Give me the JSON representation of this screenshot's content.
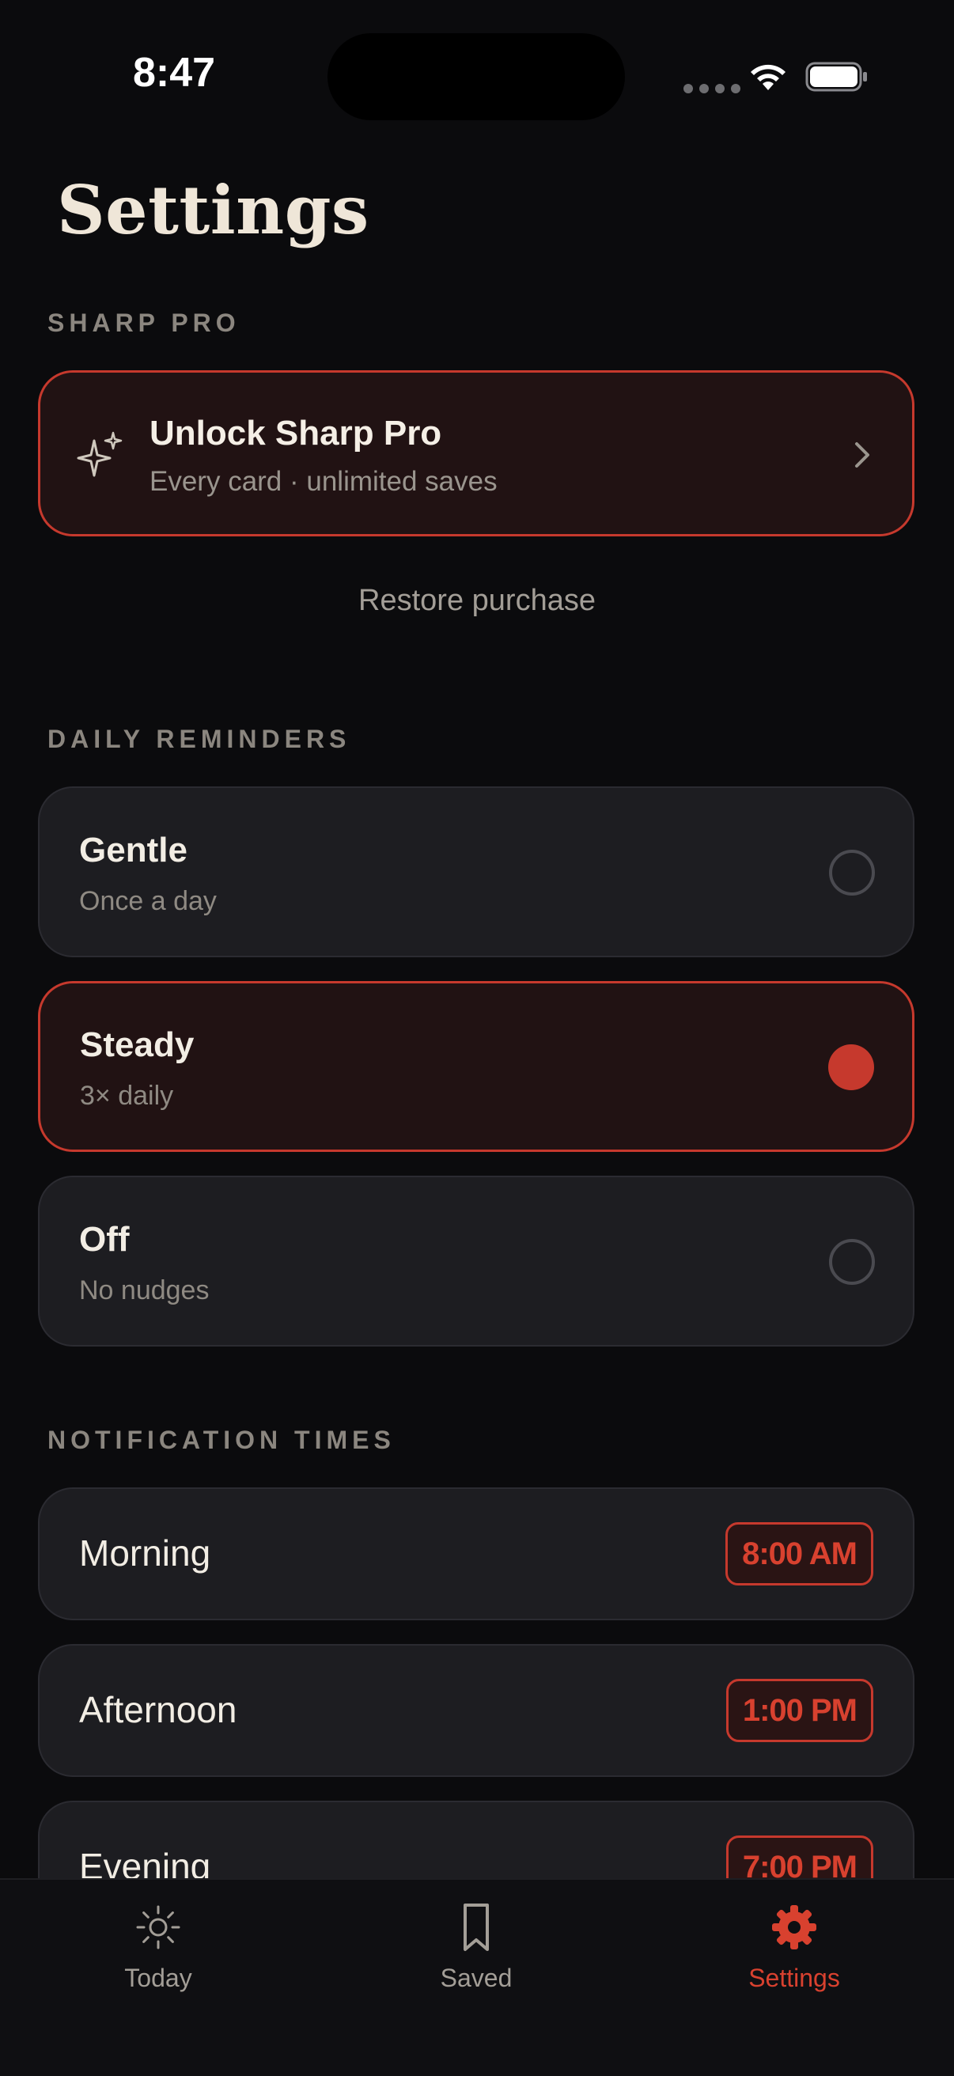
{
  "status_bar": {
    "time": "8:47"
  },
  "page": {
    "title": "Settings"
  },
  "pro_section": {
    "label": "SHARP PRO",
    "card_title": "Unlock Sharp Pro",
    "card_subtitle": "Every card · unlimited saves",
    "restore_label": "Restore purchase",
    "icon": "sparkles-icon"
  },
  "reminders_section": {
    "label": "DAILY REMINDERS",
    "options": [
      {
        "title": "Gentle",
        "subtitle": "Once a day",
        "selected": false
      },
      {
        "title": "Steady",
        "subtitle": "3× daily",
        "selected": true
      },
      {
        "title": "Off",
        "subtitle": "No nudges",
        "selected": false
      }
    ]
  },
  "times_section": {
    "label": "NOTIFICATION TIMES",
    "items": [
      {
        "label": "Morning",
        "time": "8:00 AM"
      },
      {
        "label": "Afternoon",
        "time": "1:00 PM"
      },
      {
        "label": "Evening",
        "time": "7:00 PM"
      }
    ]
  },
  "tab_bar": {
    "tabs": [
      {
        "label": "Today",
        "icon": "sun-icon",
        "active": false
      },
      {
        "label": "Saved",
        "icon": "bookmark-icon",
        "active": false
      },
      {
        "label": "Settings",
        "icon": "gear-icon",
        "active": true
      }
    ]
  },
  "colors": {
    "accent": "#c6392d",
    "background": "#0b0b0d",
    "card": "#1d1d21"
  }
}
